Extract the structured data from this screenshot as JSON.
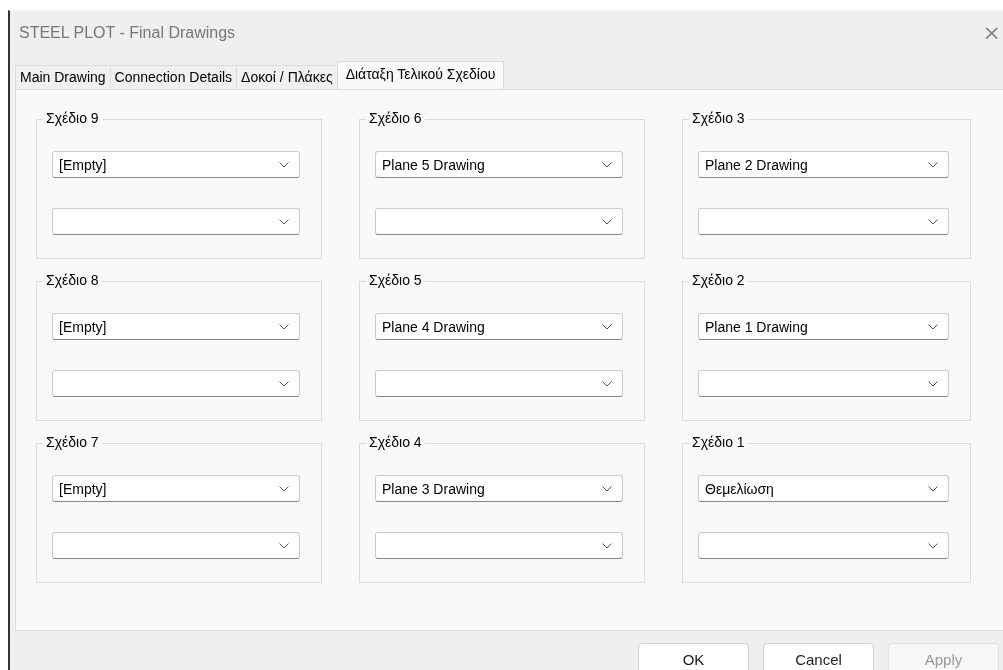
{
  "window": {
    "title": "STEEL PLOT - Final Drawings",
    "close": "×"
  },
  "tabs": [
    {
      "label": "Main Drawing",
      "selected": false
    },
    {
      "label": "Connection Details",
      "selected": false
    },
    {
      "label": "Δοκοί / Πλάκες",
      "selected": false
    },
    {
      "label": "Διάταξη Τελικού Σχεδίου",
      "selected": true
    }
  ],
  "groups": [
    {
      "title": "Σχέδιο 9",
      "selection": "[Empty]"
    },
    {
      "title": "Σχέδιο 6",
      "selection": "Plane 5 Drawing"
    },
    {
      "title": "Σχέδιο 3",
      "selection": "Plane 2 Drawing"
    },
    {
      "title": "Σχέδιο 8",
      "selection": "[Empty]"
    },
    {
      "title": "Σχέδιο 5",
      "selection": "Plane 4 Drawing"
    },
    {
      "title": "Σχέδιο 2",
      "selection": "Plane 1 Drawing"
    },
    {
      "title": "Σχέδιο 7",
      "selection": "[Empty]"
    },
    {
      "title": "Σχέδιο 4",
      "selection": "Plane 3 Drawing"
    },
    {
      "title": "Σχέδιο 1",
      "selection": "Θεμελίωση"
    }
  ],
  "buttons": [
    {
      "label": "OK",
      "disabled": false
    },
    {
      "label": "Cancel",
      "disabled": false
    },
    {
      "label": "Apply",
      "disabled": true
    }
  ]
}
